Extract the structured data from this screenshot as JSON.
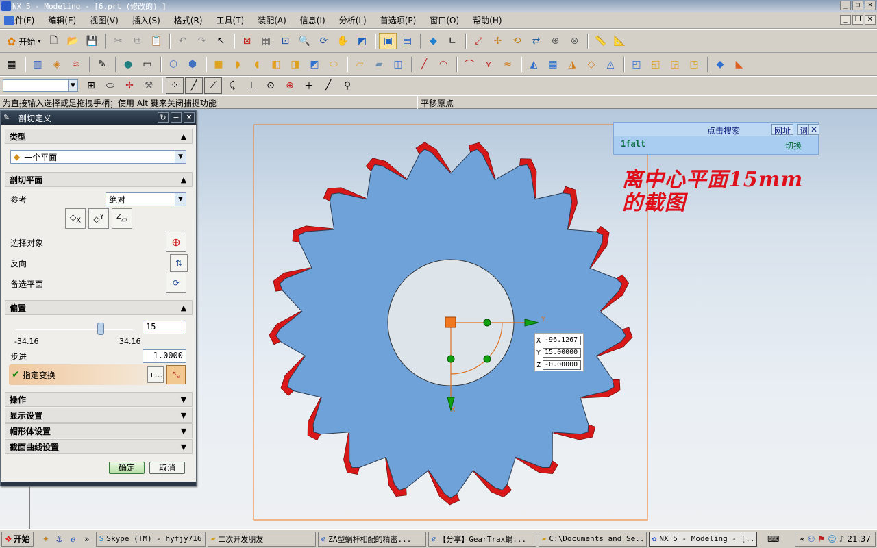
{
  "window": {
    "title": "NX 5 - Modeling - [6.prt (修改的) ]"
  },
  "menu": [
    "文件(F)",
    "编辑(E)",
    "视图(V)",
    "插入(S)",
    "格式(R)",
    "工具(T)",
    "装配(A)",
    "信息(I)",
    "分析(L)",
    "首选项(P)",
    "窗口(O)",
    "帮助(H)"
  ],
  "toolbar": {
    "start_label": "开始"
  },
  "status": {
    "prompt": "为直接输入选择或是拖拽手柄；使用 Alt 键来关闭捕捉功能",
    "message": "平移原点"
  },
  "dialog": {
    "title": "剖切定义",
    "sec_type": "类型",
    "type_value": "一个平面",
    "sec_plane": "剖切平面",
    "ref_label": "参考",
    "ref_value": "绝对",
    "axis_x": "X",
    "axis_y": "Y",
    "axis_z": "Z",
    "select_obj": "选择对象",
    "reverse": "反向",
    "alt_plane": "备选平面",
    "sec_offset": "偏置",
    "offset_value": "15",
    "offset_min": "-34.16",
    "offset_max": "34.16",
    "offset_fraction": 0.72,
    "step_label": "步进",
    "step_value": "1.0000",
    "transform_label": "指定变换",
    "sec_ops": "操作",
    "sec_display": "显示设置",
    "sec_cap": "帽形体设置",
    "sec_curves": "截面曲线设置",
    "ok": "确定",
    "cancel": "取消"
  },
  "search_panel": {
    "title": "点击搜索",
    "btn_web": "网址",
    "btn_word": "词",
    "close": "✕",
    "keyword": "1falt",
    "switch": "切换"
  },
  "annotation": {
    "line1": "离中心平面15mm",
    "line2": "的截图"
  },
  "coords": {
    "x_label": "X",
    "x_value": "-96.1267",
    "y_label": "Y",
    "y_value": "15.00000",
    "z_label": "Z",
    "z_value": "-0.00000"
  },
  "axis_labels": {
    "y": "Y",
    "x": "X"
  },
  "taskbar": {
    "start": "开始",
    "tasks": [
      {
        "label": "Skype (TM) - hyfjy716"
      },
      {
        "label": "二次开发朋友"
      },
      {
        "label": "ZA型蜗杆相配的精密..."
      },
      {
        "label": "【分享】GearTrax蜗..."
      },
      {
        "label": "C:\\Documents and Se..."
      },
      {
        "label": "NX 5 - Modeling - [..."
      }
    ],
    "clock": "21:37"
  },
  "colors": {
    "gear_face": "#6fa2d8",
    "gear_teeth": "#d81818",
    "annotation": "#e0101a",
    "viewport_frame": "#f07820"
  }
}
